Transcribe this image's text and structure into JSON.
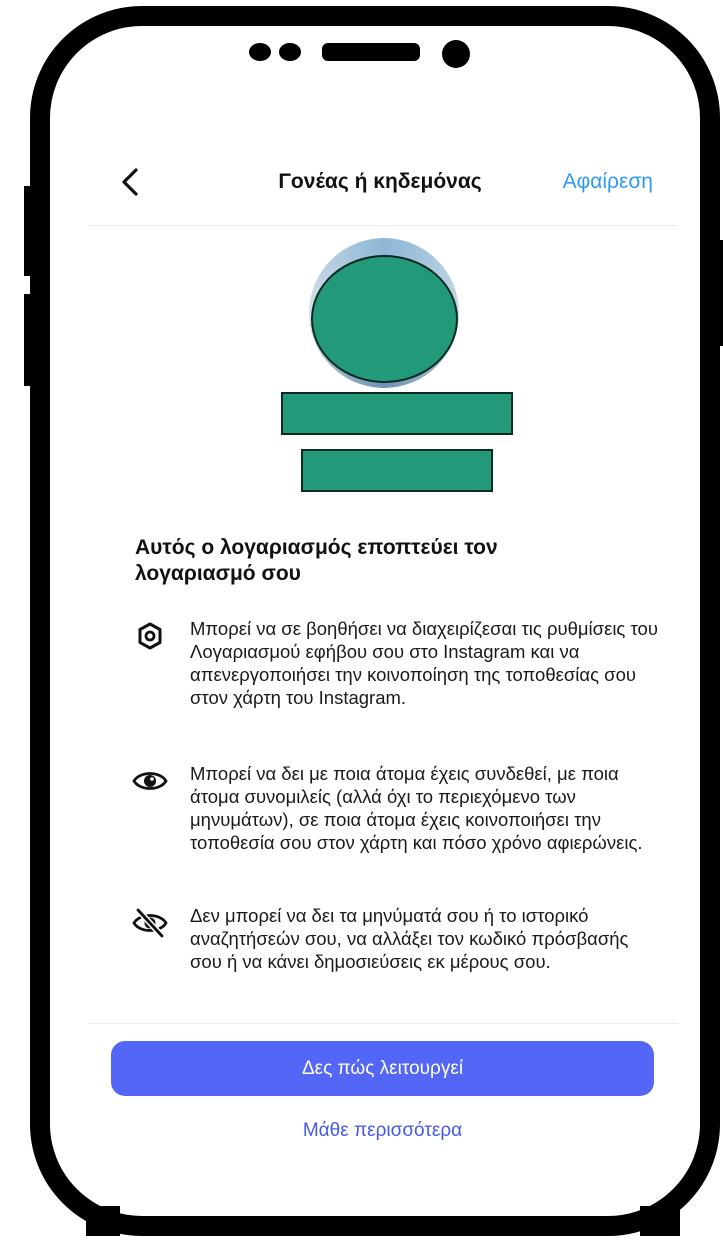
{
  "header": {
    "title": "Γονέας ή κηδεμόνας",
    "remove_label": "Αφαίρεση"
  },
  "main": {
    "heading": "Αυτός ο λογαριασμός εποπτεύει τον λογαριασμό σου",
    "features": [
      {
        "icon": "gear-icon",
        "text": "Μπορεί να σε βοηθήσει να διαχειρίζεσαι τις ρυθμίσεις του Λογαριασμού εφήβου σου στο Instagram και να απενεργοποιήσει την κοινοποίηση της τοποθεσίας σου στον χάρτη του Instagram."
      },
      {
        "icon": "eye-icon",
        "text": "Μπορεί να δει με ποια άτομα έχεις συνδεθεί, με ποια άτομα συνομιλείς (αλλά όχι το περιεχόμενο των μηνυμάτων), σε ποια άτομα έχεις κοινοποιήσει την τοποθεσία σου στον χάρτη και πόσο χρόνο αφιερώνεις."
      },
      {
        "icon": "eye-off-icon",
        "text": "Δεν μπορεί να δει τα μηνύματά σου ή το ιστορικό αναζητήσεών σου, να αλλάξει τον κωδικό πρόσβασής σου ή να κάνει δημοσιεύσεις εκ μέρους σου."
      }
    ]
  },
  "footer": {
    "primary_button_label": "Δες πώς λειτουργεί",
    "learn_more_label": "Μάθε περισσότερα"
  },
  "colors": {
    "accent_blue": "#2d9af0",
    "primary_button": "#5466f5",
    "redaction_green": "#229a7a"
  }
}
